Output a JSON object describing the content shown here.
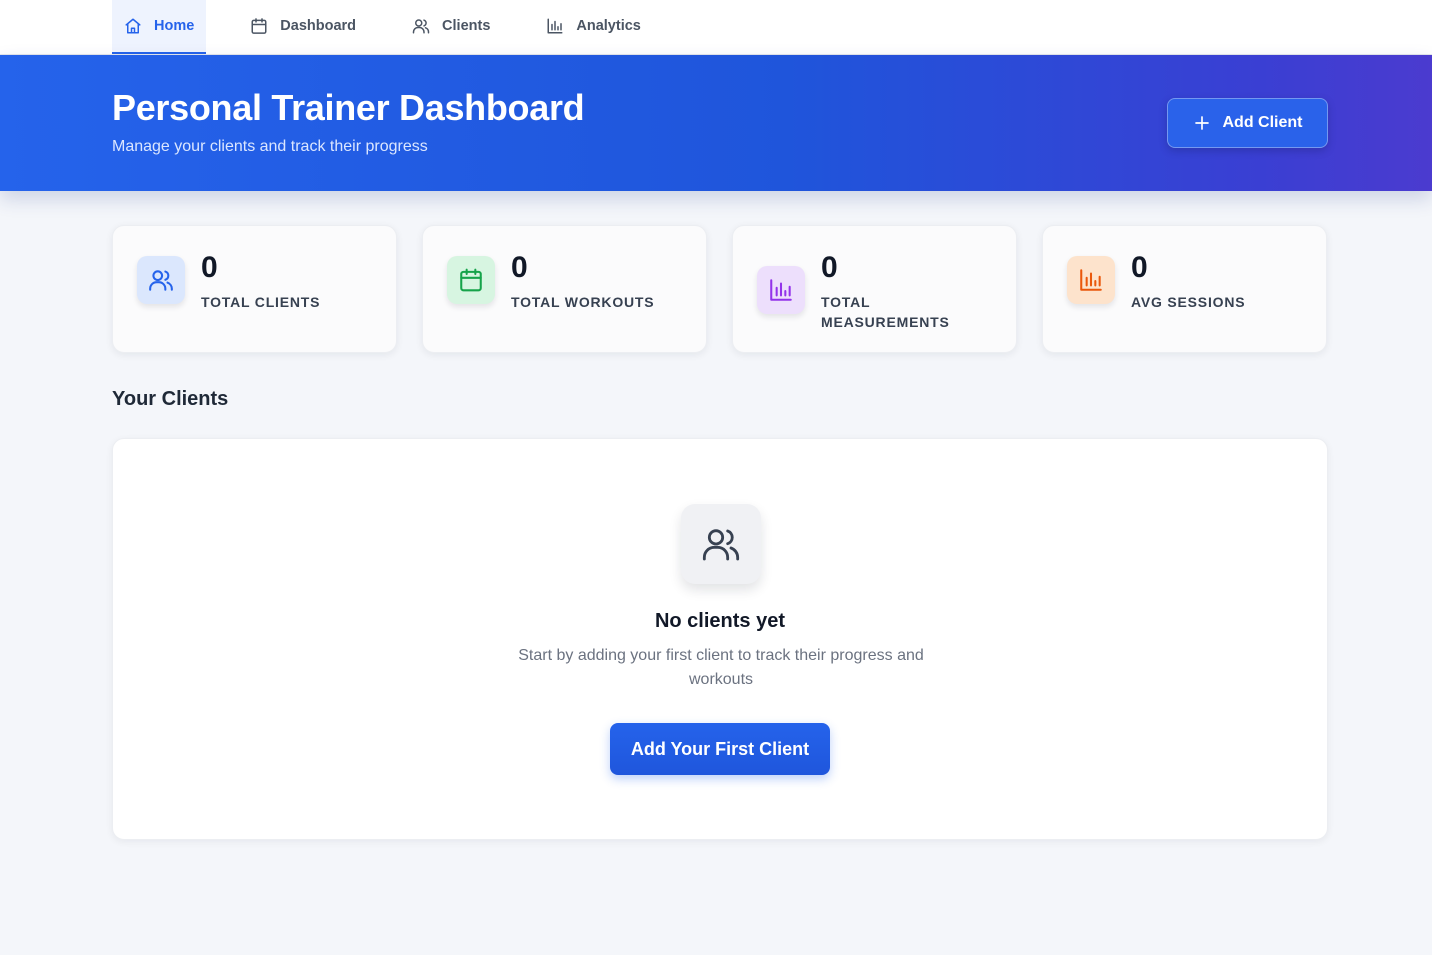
{
  "nav": {
    "items": [
      {
        "label": "Home",
        "icon": "home-icon",
        "active": true
      },
      {
        "label": "Dashboard",
        "icon": "calendar-icon",
        "active": false
      },
      {
        "label": "Clients",
        "icon": "users-icon",
        "active": false
      },
      {
        "label": "Analytics",
        "icon": "bar-chart-icon",
        "active": false
      }
    ]
  },
  "hero": {
    "title": "Personal Trainer Dashboard",
    "subtitle": "Manage your clients and track their progress",
    "add_button_label": "Add Client",
    "add_button_icon": "plus-icon"
  },
  "stats": [
    {
      "value": "0",
      "label": "Total Clients",
      "icon": "users-icon",
      "color": "#2563eb",
      "bg": "#dbe7fd"
    },
    {
      "value": "0",
      "label": "Total Workouts",
      "icon": "calendar-icon",
      "color": "#16a34a",
      "bg": "#d7f5e1"
    },
    {
      "value": "0",
      "label": "Total Measurements",
      "icon": "bar-chart-icon",
      "color": "#9333ea",
      "bg": "#eddffc"
    },
    {
      "value": "0",
      "label": "Avg Sessions",
      "icon": "bar-chart-icon",
      "color": "#ea580c",
      "bg": "#fde3cc"
    }
  ],
  "clients_section": {
    "title": "Your Clients",
    "empty_icon": "users-icon",
    "empty_title": "No clients yet",
    "empty_text": "Start by adding your first client to track their progress and workouts",
    "cta_label": "Add Your First Client"
  },
  "colors": {
    "accent": "#2563eb",
    "hero_gradient_start": "#2563eb",
    "hero_gradient_end": "#4b3bcf",
    "page_background": "#f4f6fa"
  }
}
